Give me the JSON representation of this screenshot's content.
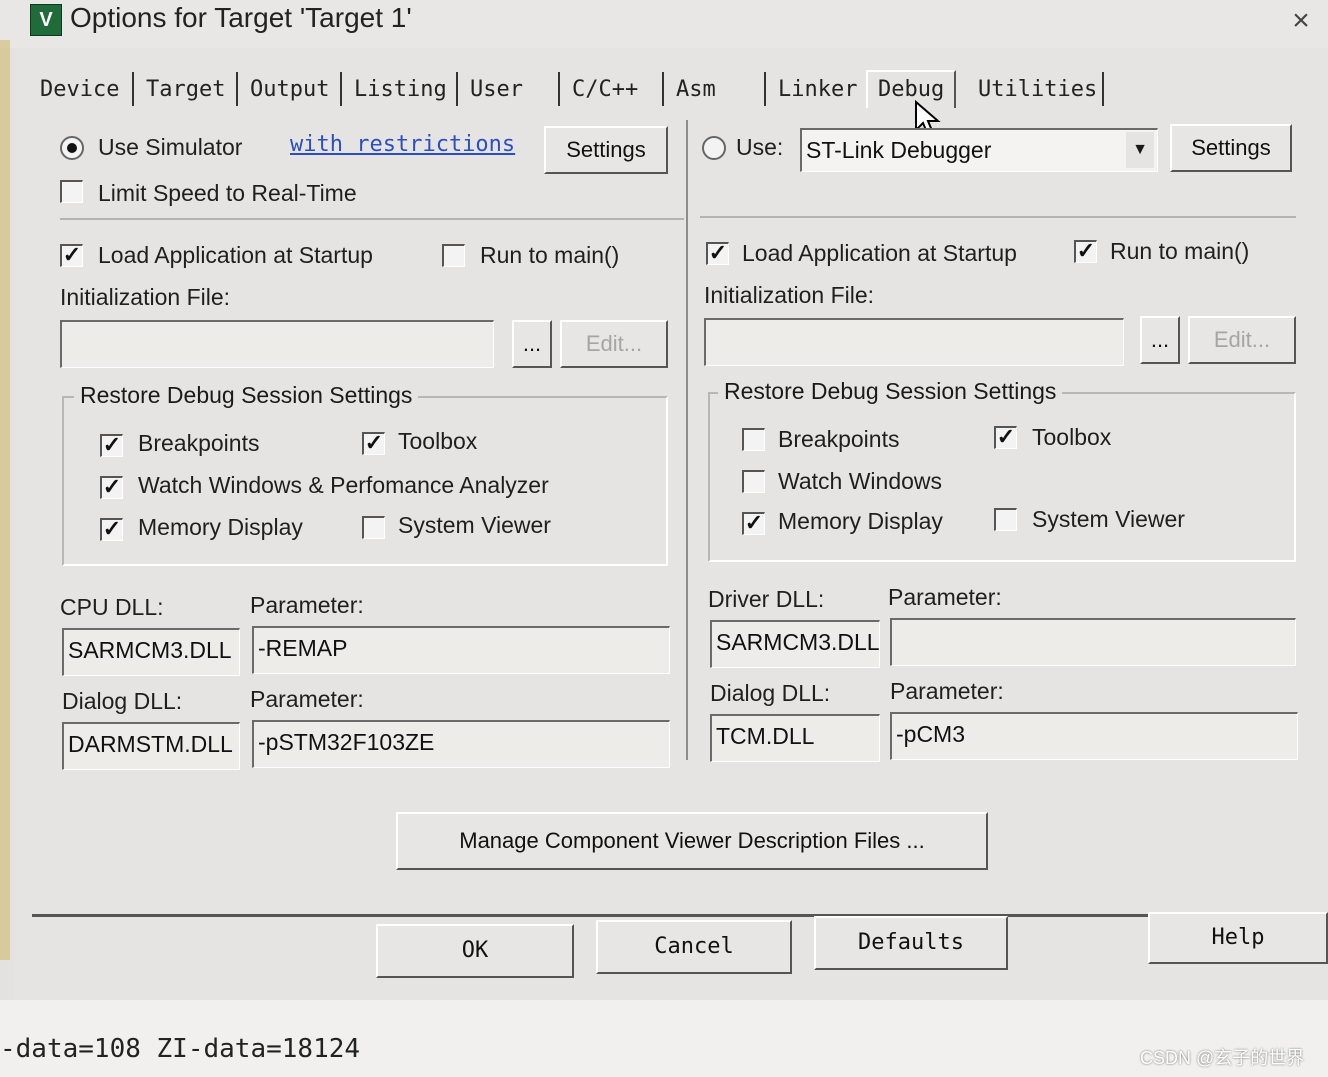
{
  "window": {
    "title": "Options for Target 'Target 1'",
    "icon_label": "V",
    "close_glyph": "×"
  },
  "tabs": [
    "Device",
    "Target",
    "Output",
    "Listing",
    "User",
    "C/C++",
    "Asm",
    "Linker",
    "Debug",
    "Utilities"
  ],
  "active_tab": "Debug",
  "left": {
    "use_simulator_label": "Use Simulator",
    "use_simulator_selected": true,
    "restrictions_link": "with restrictions",
    "settings_label": "Settings",
    "limit_speed_label": "Limit Speed to Real-Time",
    "limit_speed_checked": false,
    "load_app_label": "Load Application at Startup",
    "load_app_checked": true,
    "run_to_main_label": "Run to main()",
    "run_to_main_checked": false,
    "init_file_label": "Initialization File:",
    "init_file_value": "",
    "browse_label": "...",
    "edit_label": "Edit...",
    "restore_title": "Restore Debug Session Settings",
    "breakpoints_label": "Breakpoints",
    "breakpoints_checked": true,
    "toolbox_label": "Toolbox",
    "toolbox_checked": true,
    "watch_label": "Watch Windows & Perfomance Analyzer",
    "watch_checked": true,
    "memory_label": "Memory Display",
    "memory_checked": true,
    "sysviewer_label": "System Viewer",
    "sysviewer_checked": false,
    "cpu_dll_label": "CPU DLL:",
    "cpu_dll_value": "SARMCM3.DLL",
    "cpu_param_label": "Parameter:",
    "cpu_param_value": "-REMAP",
    "dialog_dll_label": "Dialog DLL:",
    "dialog_dll_value": "DARMSTM.DLL",
    "dialog_param_label": "Parameter:",
    "dialog_param_value": "-pSTM32F103ZE"
  },
  "right": {
    "use_label": "Use:",
    "use_selected": false,
    "debugger_value": "ST-Link Debugger",
    "dropdown_glyph": "▼",
    "settings_label": "Settings",
    "load_app_label": "Load Application at Startup",
    "load_app_checked": true,
    "run_to_main_label": "Run to main()",
    "run_to_main_checked": true,
    "init_file_label": "Initialization File:",
    "init_file_value": "",
    "browse_label": "...",
    "edit_label": "Edit...",
    "restore_title": "Restore Debug Session Settings",
    "breakpoints_label": "Breakpoints",
    "breakpoints_checked": false,
    "toolbox_label": "Toolbox",
    "toolbox_checked": true,
    "watch_label": "Watch Windows",
    "watch_checked": false,
    "memory_label": "Memory Display",
    "memory_checked": true,
    "sysviewer_label": "System Viewer",
    "sysviewer_checked": false,
    "driver_dll_label": "Driver DLL:",
    "driver_dll_value": "SARMCM3.DLL",
    "driver_param_label": "Parameter:",
    "driver_param_value": "",
    "dialog_dll_label": "Dialog DLL:",
    "dialog_dll_value": "TCM.DLL",
    "dialog_param_label": "Parameter:",
    "dialog_param_value": "-pCM3"
  },
  "manage_button": "Manage Component Viewer Description Files ...",
  "footer": {
    "ok": "OK",
    "cancel": "Cancel",
    "defaults": "Defaults",
    "help": "Help"
  },
  "status_text": "-data=108 ZI-data=18124",
  "watermark": "CSDN @玄子的世界"
}
